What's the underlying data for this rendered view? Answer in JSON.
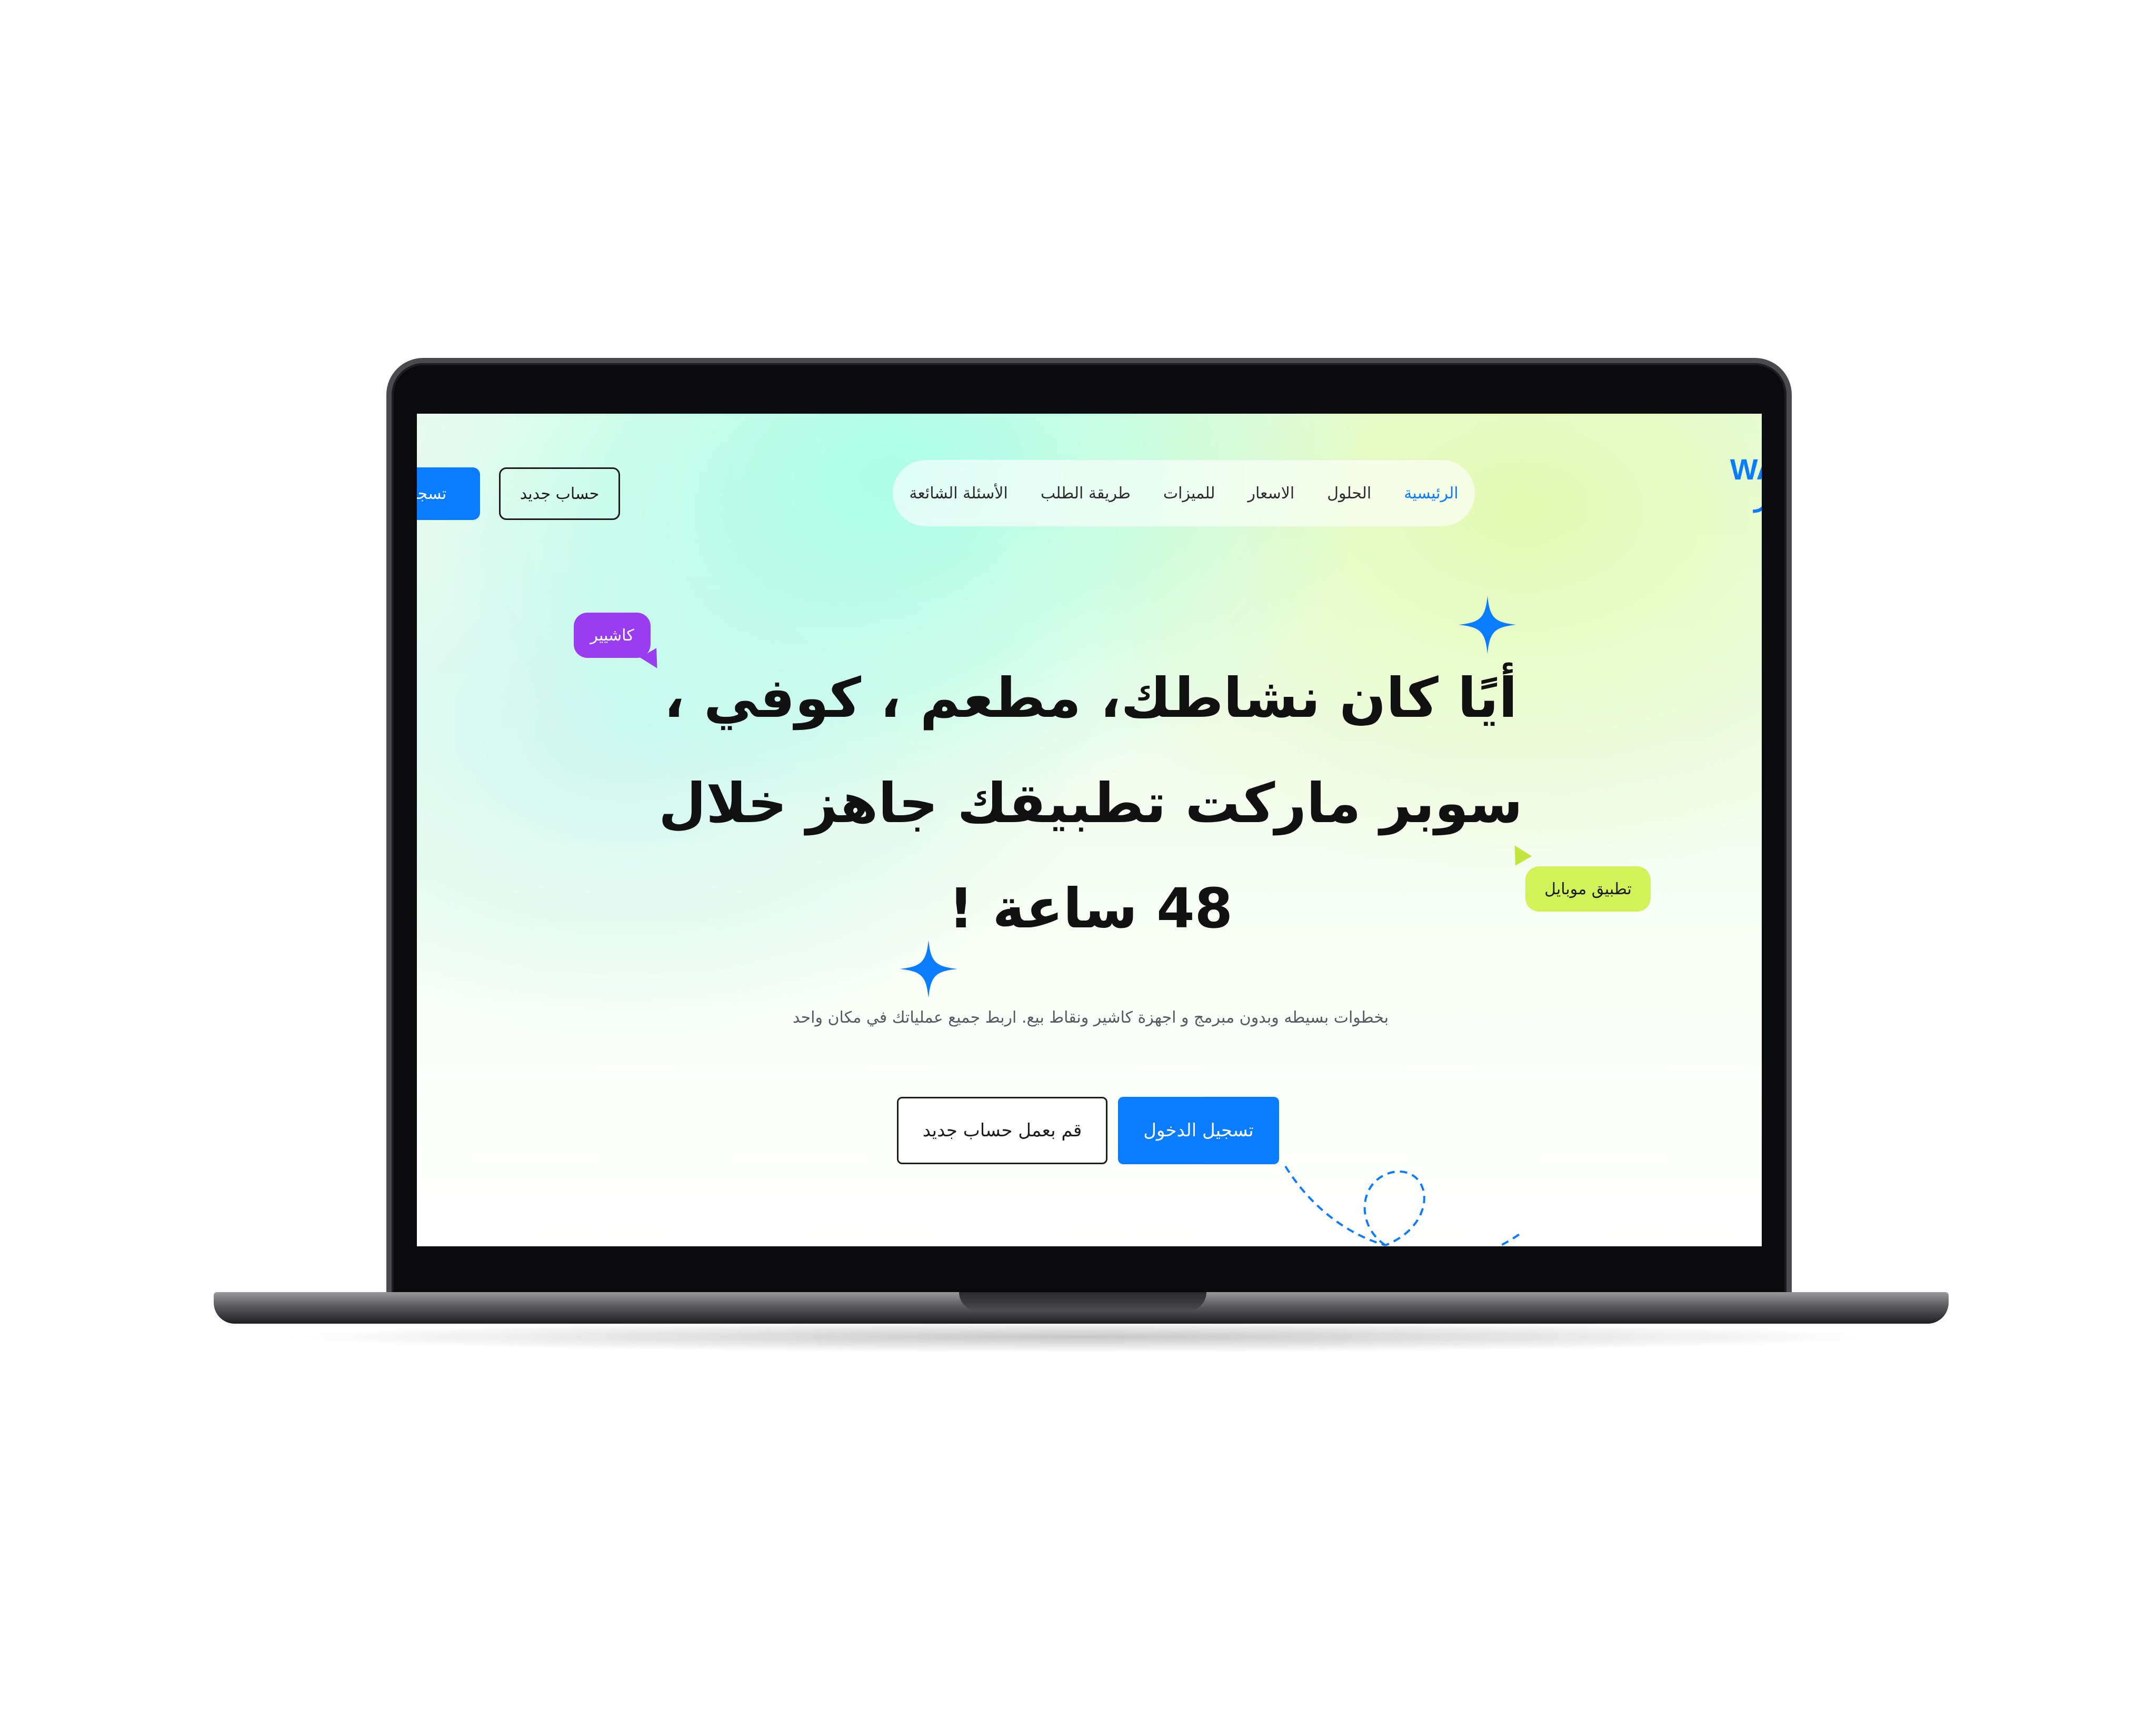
{
  "header": {
    "logo_text": "WA",
    "logo_sub": "ـر",
    "nav": [
      {
        "label": "الرئيسية",
        "active": true
      },
      {
        "label": "الحلول",
        "active": false
      },
      {
        "label": "الاسعار",
        "active": false
      },
      {
        "label": "للميزات",
        "active": false
      },
      {
        "label": "طريقة الطلب",
        "active": false
      },
      {
        "label": "الأسئلة الشائعة",
        "active": false
      }
    ],
    "new_account_label": "حساب جديد",
    "register_label": "تسجيل"
  },
  "hero": {
    "title_line1": "أيًا كان نشاطك، مطعم ، كوفي ،",
    "title_line2": "سوبر ماركت تطبيقك جاهز خلال",
    "title_line3": "48 ساعة !",
    "subtitle": "بخطوات بسيطه وبدون مبرمج و اجهزة كاشير ونقاط بيع. اربط جميع عملياتك في مكان واحد",
    "login_label": "تسجيل الدخول",
    "create_account_label": "قم بعمل حساب جديد",
    "badge_cashier": "كاشيير",
    "badge_mobile": "تطبيق موبايل"
  },
  "colors": {
    "accent": "#0a7cff",
    "badge_purple": "#9a3df0",
    "badge_lime": "#d2f25a"
  },
  "icons": {
    "sparkle": "four-point-star-icon"
  }
}
